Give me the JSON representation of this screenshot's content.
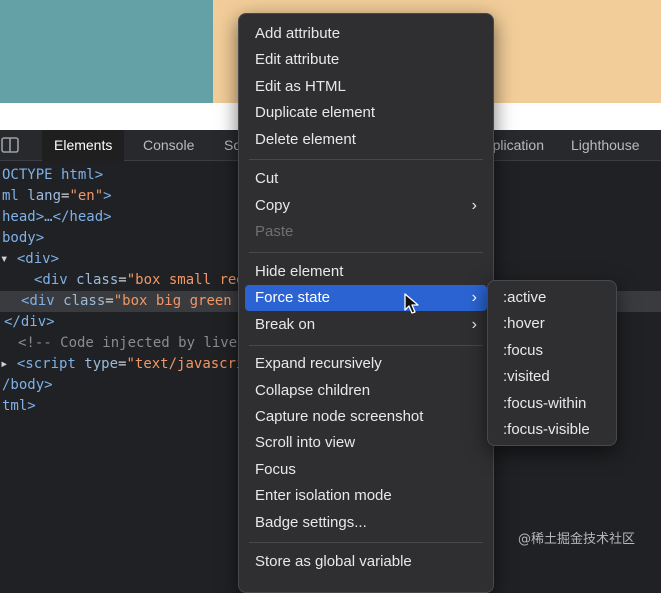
{
  "colors": {
    "teal_box": "#63a1a7",
    "peach_box": "#f2cd99",
    "highlight": "#2b64d2",
    "menu_bg": "#2f2f32",
    "devtools_bg": "#202124"
  },
  "toolbar": {
    "icon": "dock-side-icon",
    "tabs": {
      "elements": "Elements",
      "console": "Console",
      "sources": "Sources",
      "application": "Application",
      "lighthouse": "Lighthouse"
    }
  },
  "code": {
    "l1": "OCTYPE html>",
    "l2_tag": "ml",
    "l2_attr": " lang",
    "l2_eq": "=",
    "l2_val": "\"en\"",
    "l2_end": ">",
    "l3": "head>…</head>",
    "l4": "body>",
    "l5_arrow": "▾ ",
    "l5": "<div>",
    "l6_tag": "<div",
    "l6_attr": " class",
    "l6_eq": "=",
    "l6_val": "\"box small red",
    "l7_tag": "<div",
    "l7_attr": " class",
    "l7_eq": "=",
    "l7_val": "\"box big green",
    "l8": "</div>",
    "l9": "<!-- Code injected by live-",
    "l10_arrow": "▸ ",
    "l10_tag": "<script",
    "l10_attr": " type",
    "l10_eq": "=",
    "l10_val": "\"text/javascri",
    "l11": "/body>",
    "l12": "tml>"
  },
  "context_menu": {
    "add_attribute": "Add attribute",
    "edit_attribute": "Edit attribute",
    "edit_as_html": "Edit as HTML",
    "duplicate_element": "Duplicate element",
    "delete_element": "Delete element",
    "cut": "Cut",
    "copy": "Copy",
    "paste": "Paste",
    "hide_element": "Hide element",
    "force_state": "Force state",
    "break_on": "Break on",
    "expand_recursively": "Expand recursively",
    "collapse_children": "Collapse children",
    "capture_node_screenshot": "Capture node screenshot",
    "scroll_into_view": "Scroll into view",
    "focus": "Focus",
    "enter_isolation_mode": "Enter isolation mode",
    "badge_settings": "Badge settings...",
    "store_as_global_variable": "Store as global variable",
    "chevron": "›"
  },
  "force_state_submenu": [
    ":active",
    ":hover",
    ":focus",
    ":visited",
    ":focus-within",
    ":focus-visible"
  ],
  "watermark": "@稀土掘金技术社区"
}
